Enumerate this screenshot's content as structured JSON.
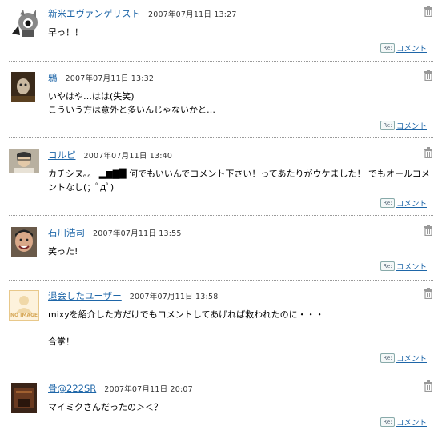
{
  "reply_label": "コメント",
  "reply_icon": "Re:",
  "comments": [
    {
      "user": "新米エヴァンゲリスト",
      "date": "2007年07月11日 13:27",
      "text": "早っ！！"
    },
    {
      "user": "鴉",
      "date": "2007年07月11日 13:32",
      "text": "いやはや…はは(失笑)\nこういう方は意外と多いんじゃないかと…"
    },
    {
      "user": "コルピ",
      "date": "2007年07月11日 13:40",
      "text": "カチシヌ。。 ▂▆▇█ 何でもいいんでコメント下さい！ってあたりがウケました！ でもオールコメントなし(；ﾟдﾟ)"
    },
    {
      "user": "石川浩司",
      "date": "2007年07月11日 13:55",
      "text": "笑った!"
    },
    {
      "user": "退会したユーザー",
      "date": "2007年07月11日 13:58",
      "text": "mixyを紹介した方だけでもコメントしてあげれば救われたのに・・・\n\n合掌！",
      "avatar_label": "NO IMAGE"
    },
    {
      "user": "骨@222SR",
      "date": "2007年07月11日 20:07",
      "text": "マイミクさんだったの＞＜？"
    }
  ]
}
